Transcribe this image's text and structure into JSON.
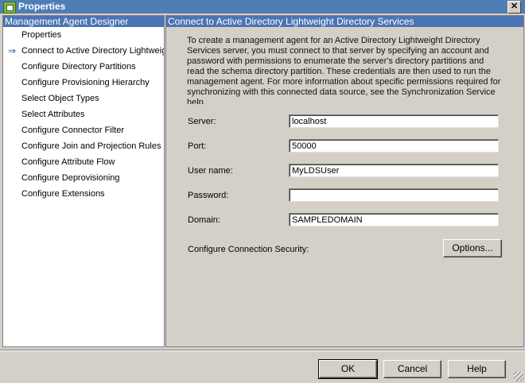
{
  "window": {
    "title": "Properties",
    "close_glyph": "✕"
  },
  "left_panel": {
    "header": "Management Agent Designer",
    "items": [
      {
        "label": "Properties"
      },
      {
        "label": "Connect to Active Directory Lightweight Directory Services",
        "selected": true
      },
      {
        "label": "Configure Directory Partitions"
      },
      {
        "label": "Configure Provisioning Hierarchy"
      },
      {
        "label": "Select Object Types"
      },
      {
        "label": "Select Attributes"
      },
      {
        "label": "Configure Connector Filter"
      },
      {
        "label": "Configure Join and Projection Rules"
      },
      {
        "label": "Configure Attribute Flow"
      },
      {
        "label": "Configure Deprovisioning"
      },
      {
        "label": "Configure Extensions"
      }
    ],
    "current_marker": "⇒"
  },
  "right_panel": {
    "header": "Connect to Active Directory Lightweight Directory Services",
    "description": "To create a management agent for an Active Directory Lightweight Directory Services server, you must connect to that server by specifying an account and password with permissions to enumerate the server's directory partitions and read the schema directory partition. These credentials are then used to run the management agent. For more information about specific permissions required for synchronizing with this connected data source, see the Synchronization Service help.",
    "fields": {
      "server": {
        "label": "Server:",
        "value": "localhost"
      },
      "port": {
        "label": "Port:",
        "value": "50000"
      },
      "username": {
        "label": "User name:",
        "value": "MyLDSUser"
      },
      "password": {
        "label": "Password:",
        "value": ""
      },
      "domain": {
        "label": "Domain:",
        "value": "SAMPLEDOMAIN"
      }
    },
    "security": {
      "label": "Configure Connection Security:",
      "button": "Options..."
    }
  },
  "footer": {
    "ok": "OK",
    "cancel": "Cancel",
    "help": "Help"
  },
  "colors": {
    "header_blue": "#4a74b4",
    "dialog_gray": "#d4d0c8"
  }
}
